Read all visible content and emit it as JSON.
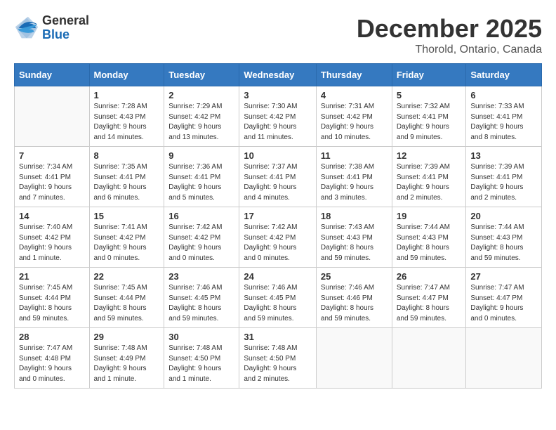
{
  "header": {
    "logo_general": "General",
    "logo_blue": "Blue",
    "title": "December 2025",
    "subtitle": "Thorold, Ontario, Canada"
  },
  "days_of_week": [
    "Sunday",
    "Monday",
    "Tuesday",
    "Wednesday",
    "Thursday",
    "Friday",
    "Saturday"
  ],
  "weeks": [
    [
      {
        "day": "",
        "info": ""
      },
      {
        "day": "1",
        "info": "Sunrise: 7:28 AM\nSunset: 4:43 PM\nDaylight: 9 hours\nand 14 minutes."
      },
      {
        "day": "2",
        "info": "Sunrise: 7:29 AM\nSunset: 4:42 PM\nDaylight: 9 hours\nand 13 minutes."
      },
      {
        "day": "3",
        "info": "Sunrise: 7:30 AM\nSunset: 4:42 PM\nDaylight: 9 hours\nand 11 minutes."
      },
      {
        "day": "4",
        "info": "Sunrise: 7:31 AM\nSunset: 4:42 PM\nDaylight: 9 hours\nand 10 minutes."
      },
      {
        "day": "5",
        "info": "Sunrise: 7:32 AM\nSunset: 4:41 PM\nDaylight: 9 hours\nand 9 minutes."
      },
      {
        "day": "6",
        "info": "Sunrise: 7:33 AM\nSunset: 4:41 PM\nDaylight: 9 hours\nand 8 minutes."
      }
    ],
    [
      {
        "day": "7",
        "info": "Sunrise: 7:34 AM\nSunset: 4:41 PM\nDaylight: 9 hours\nand 7 minutes."
      },
      {
        "day": "8",
        "info": "Sunrise: 7:35 AM\nSunset: 4:41 PM\nDaylight: 9 hours\nand 6 minutes."
      },
      {
        "day": "9",
        "info": "Sunrise: 7:36 AM\nSunset: 4:41 PM\nDaylight: 9 hours\nand 5 minutes."
      },
      {
        "day": "10",
        "info": "Sunrise: 7:37 AM\nSunset: 4:41 PM\nDaylight: 9 hours\nand 4 minutes."
      },
      {
        "day": "11",
        "info": "Sunrise: 7:38 AM\nSunset: 4:41 PM\nDaylight: 9 hours\nand 3 minutes."
      },
      {
        "day": "12",
        "info": "Sunrise: 7:39 AM\nSunset: 4:41 PM\nDaylight: 9 hours\nand 2 minutes."
      },
      {
        "day": "13",
        "info": "Sunrise: 7:39 AM\nSunset: 4:41 PM\nDaylight: 9 hours\nand 2 minutes."
      }
    ],
    [
      {
        "day": "14",
        "info": "Sunrise: 7:40 AM\nSunset: 4:42 PM\nDaylight: 9 hours\nand 1 minute."
      },
      {
        "day": "15",
        "info": "Sunrise: 7:41 AM\nSunset: 4:42 PM\nDaylight: 9 hours\nand 0 minutes."
      },
      {
        "day": "16",
        "info": "Sunrise: 7:42 AM\nSunset: 4:42 PM\nDaylight: 9 hours\nand 0 minutes."
      },
      {
        "day": "17",
        "info": "Sunrise: 7:42 AM\nSunset: 4:42 PM\nDaylight: 9 hours\nand 0 minutes."
      },
      {
        "day": "18",
        "info": "Sunrise: 7:43 AM\nSunset: 4:43 PM\nDaylight: 8 hours\nand 59 minutes."
      },
      {
        "day": "19",
        "info": "Sunrise: 7:44 AM\nSunset: 4:43 PM\nDaylight: 8 hours\nand 59 minutes."
      },
      {
        "day": "20",
        "info": "Sunrise: 7:44 AM\nSunset: 4:43 PM\nDaylight: 8 hours\nand 59 minutes."
      }
    ],
    [
      {
        "day": "21",
        "info": "Sunrise: 7:45 AM\nSunset: 4:44 PM\nDaylight: 8 hours\nand 59 minutes."
      },
      {
        "day": "22",
        "info": "Sunrise: 7:45 AM\nSunset: 4:44 PM\nDaylight: 8 hours\nand 59 minutes."
      },
      {
        "day": "23",
        "info": "Sunrise: 7:46 AM\nSunset: 4:45 PM\nDaylight: 8 hours\nand 59 minutes."
      },
      {
        "day": "24",
        "info": "Sunrise: 7:46 AM\nSunset: 4:45 PM\nDaylight: 8 hours\nand 59 minutes."
      },
      {
        "day": "25",
        "info": "Sunrise: 7:46 AM\nSunset: 4:46 PM\nDaylight: 8 hours\nand 59 minutes."
      },
      {
        "day": "26",
        "info": "Sunrise: 7:47 AM\nSunset: 4:47 PM\nDaylight: 8 hours\nand 59 minutes."
      },
      {
        "day": "27",
        "info": "Sunrise: 7:47 AM\nSunset: 4:47 PM\nDaylight: 9 hours\nand 0 minutes."
      }
    ],
    [
      {
        "day": "28",
        "info": "Sunrise: 7:47 AM\nSunset: 4:48 PM\nDaylight: 9 hours\nand 0 minutes."
      },
      {
        "day": "29",
        "info": "Sunrise: 7:48 AM\nSunset: 4:49 PM\nDaylight: 9 hours\nand 1 minute."
      },
      {
        "day": "30",
        "info": "Sunrise: 7:48 AM\nSunset: 4:50 PM\nDaylight: 9 hours\nand 1 minute."
      },
      {
        "day": "31",
        "info": "Sunrise: 7:48 AM\nSunset: 4:50 PM\nDaylight: 9 hours\nand 2 minutes."
      },
      {
        "day": "",
        "info": ""
      },
      {
        "day": "",
        "info": ""
      },
      {
        "day": "",
        "info": ""
      }
    ]
  ]
}
